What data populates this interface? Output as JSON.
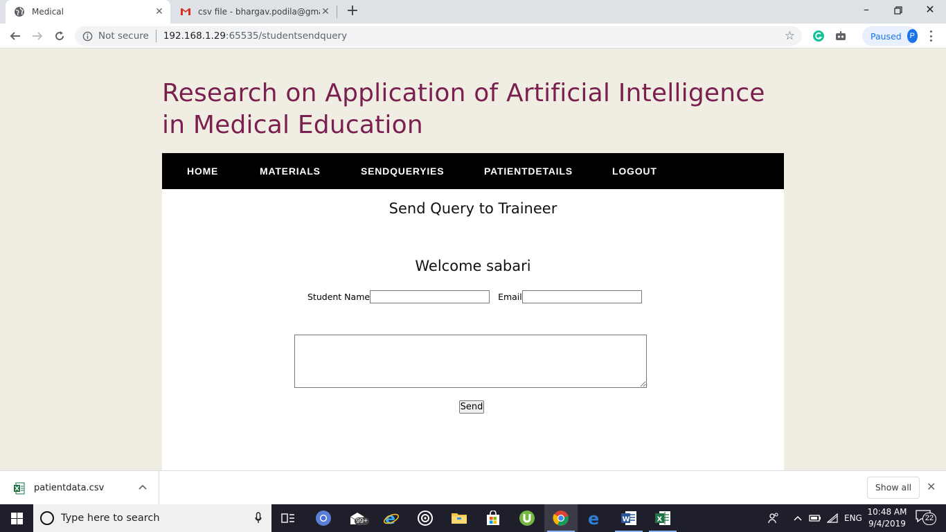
{
  "browser": {
    "tabs": [
      {
        "title": "Medical",
        "icon": "globe-icon",
        "active": true
      },
      {
        "title": "csv file - bhargav.podila@gmail.c",
        "icon": "gmail-icon",
        "active": false
      }
    ],
    "address": {
      "security_label": "Not secure",
      "host": "192.168.1.29",
      "path": ":65535/studentsendquery"
    },
    "profile": {
      "status": "Paused",
      "avatar_letter": "P"
    }
  },
  "site": {
    "title": "Research on Application of Artificial Intelligence in Medical Education",
    "nav": [
      {
        "label": "HOME"
      },
      {
        "label": "MATERIALS"
      },
      {
        "label": "SENDQUERYIES"
      },
      {
        "label": "PATIENTDETAILS"
      },
      {
        "label": "LOGOUT"
      }
    ]
  },
  "form": {
    "heading": "Send Query to Traineer",
    "welcome": "Welcome sabari",
    "student_name_label": "Student Name",
    "student_name_value": "",
    "email_label": "Email",
    "email_value": "",
    "query_value": "",
    "send_label": "Send"
  },
  "downloads": {
    "file_name": "patientdata.csv",
    "show_all_label": "Show all"
  },
  "taskbar": {
    "search_placeholder": "Type here to search",
    "mail_badge": "99+",
    "language": "ENG",
    "time": "10:48 AM",
    "date": "9/4/2019",
    "notification_count": "22"
  },
  "colors": {
    "page_background": "#f0eee2",
    "title_color": "#7a1f4f",
    "nav_background": "#000000",
    "nav_text": "#ffffff",
    "profile_accent": "#1a73e8"
  }
}
